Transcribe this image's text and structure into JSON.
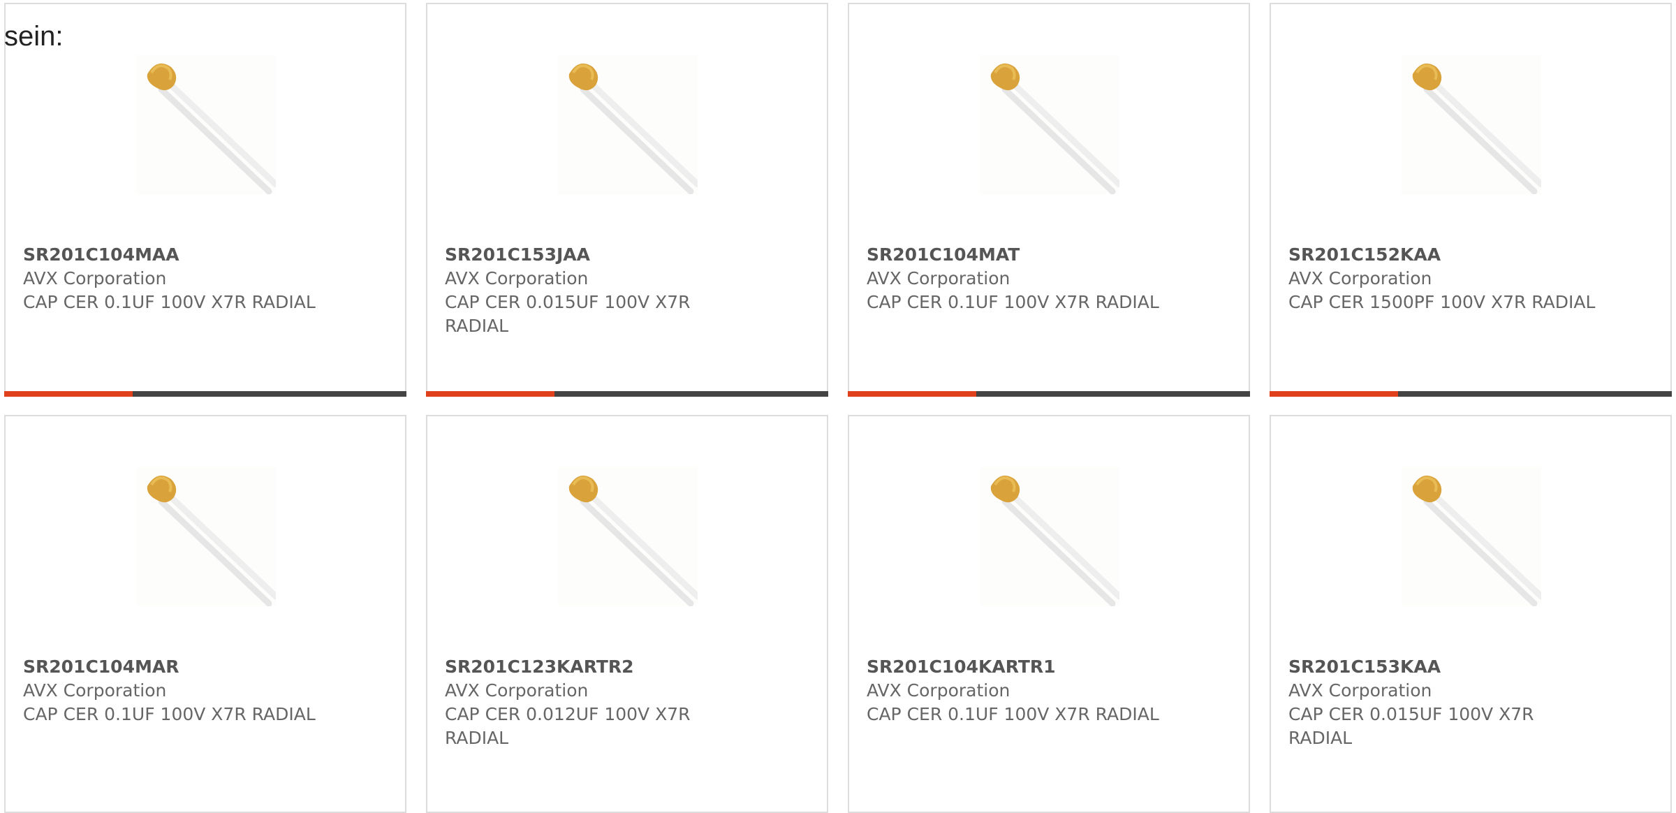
{
  "lead_text": "sein:",
  "accent_color": "#e0401c",
  "bar_color": "#444444",
  "products": [
    {
      "part_number": "SR201C104MAA",
      "manufacturer": "AVX Corporation",
      "description": "CAP CER 0.1UF 100V X7R RADIAL",
      "image_icon": "radial-capacitor-image"
    },
    {
      "part_number": "SR201C153JAA",
      "manufacturer": "AVX Corporation",
      "description": "CAP CER 0.015UF 100V X7R RADIAL",
      "image_icon": "radial-capacitor-image"
    },
    {
      "part_number": "SR201C104MAT",
      "manufacturer": "AVX Corporation",
      "description": "CAP CER 0.1UF 100V X7R RADIAL",
      "image_icon": "radial-capacitor-image"
    },
    {
      "part_number": "SR201C152KAA",
      "manufacturer": "AVX Corporation",
      "description": "CAP CER 1500PF 100V X7R RADIAL",
      "image_icon": "radial-capacitor-image"
    },
    {
      "part_number": "SR201C104MAR",
      "manufacturer": "AVX Corporation",
      "description": "CAP CER 0.1UF 100V X7R RADIAL",
      "image_icon": "radial-capacitor-image"
    },
    {
      "part_number": "SR201C123KARTR2",
      "manufacturer": "AVX Corporation",
      "description": "CAP CER 0.012UF 100V X7R RADIAL",
      "image_icon": "radial-capacitor-image"
    },
    {
      "part_number": "SR201C104KARTR1",
      "manufacturer": "AVX Corporation",
      "description": "CAP CER 0.1UF 100V X7R RADIAL",
      "image_icon": "radial-capacitor-image"
    },
    {
      "part_number": "SR201C153KAA",
      "manufacturer": "AVX Corporation",
      "description": "CAP CER 0.015UF 100V X7R RADIAL",
      "image_icon": "radial-capacitor-image"
    }
  ]
}
